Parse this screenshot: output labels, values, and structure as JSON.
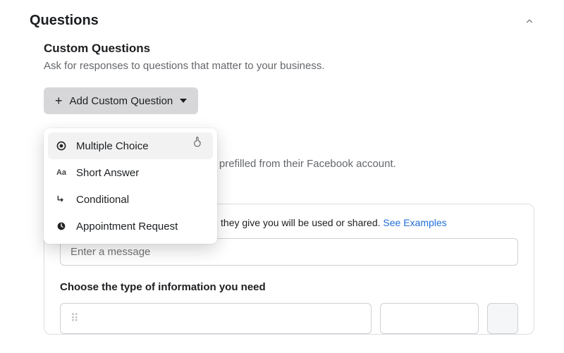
{
  "section": {
    "title": "Questions"
  },
  "custom": {
    "title": "Custom Questions",
    "desc": "Ask for responses to questions that matter to your business.",
    "add_button": "Add Custom Question"
  },
  "dropdown": {
    "items": [
      {
        "label": "Multiple Choice",
        "icon": "radio-icon"
      },
      {
        "label": "Short Answer",
        "icon": "text-aa-icon"
      },
      {
        "label": "Conditional",
        "icon": "branch-arrow-icon"
      },
      {
        "label": "Appointment Request",
        "icon": "clock-icon"
      }
    ]
  },
  "behind": {
    "prefill_tail": "be prefilled from their Facebook account."
  },
  "card": {
    "consent_tail": "they give you will be used or shared.",
    "see_examples": "See Examples",
    "message_placeholder": "Enter a message",
    "choose_label": "Choose the type of information you need"
  }
}
